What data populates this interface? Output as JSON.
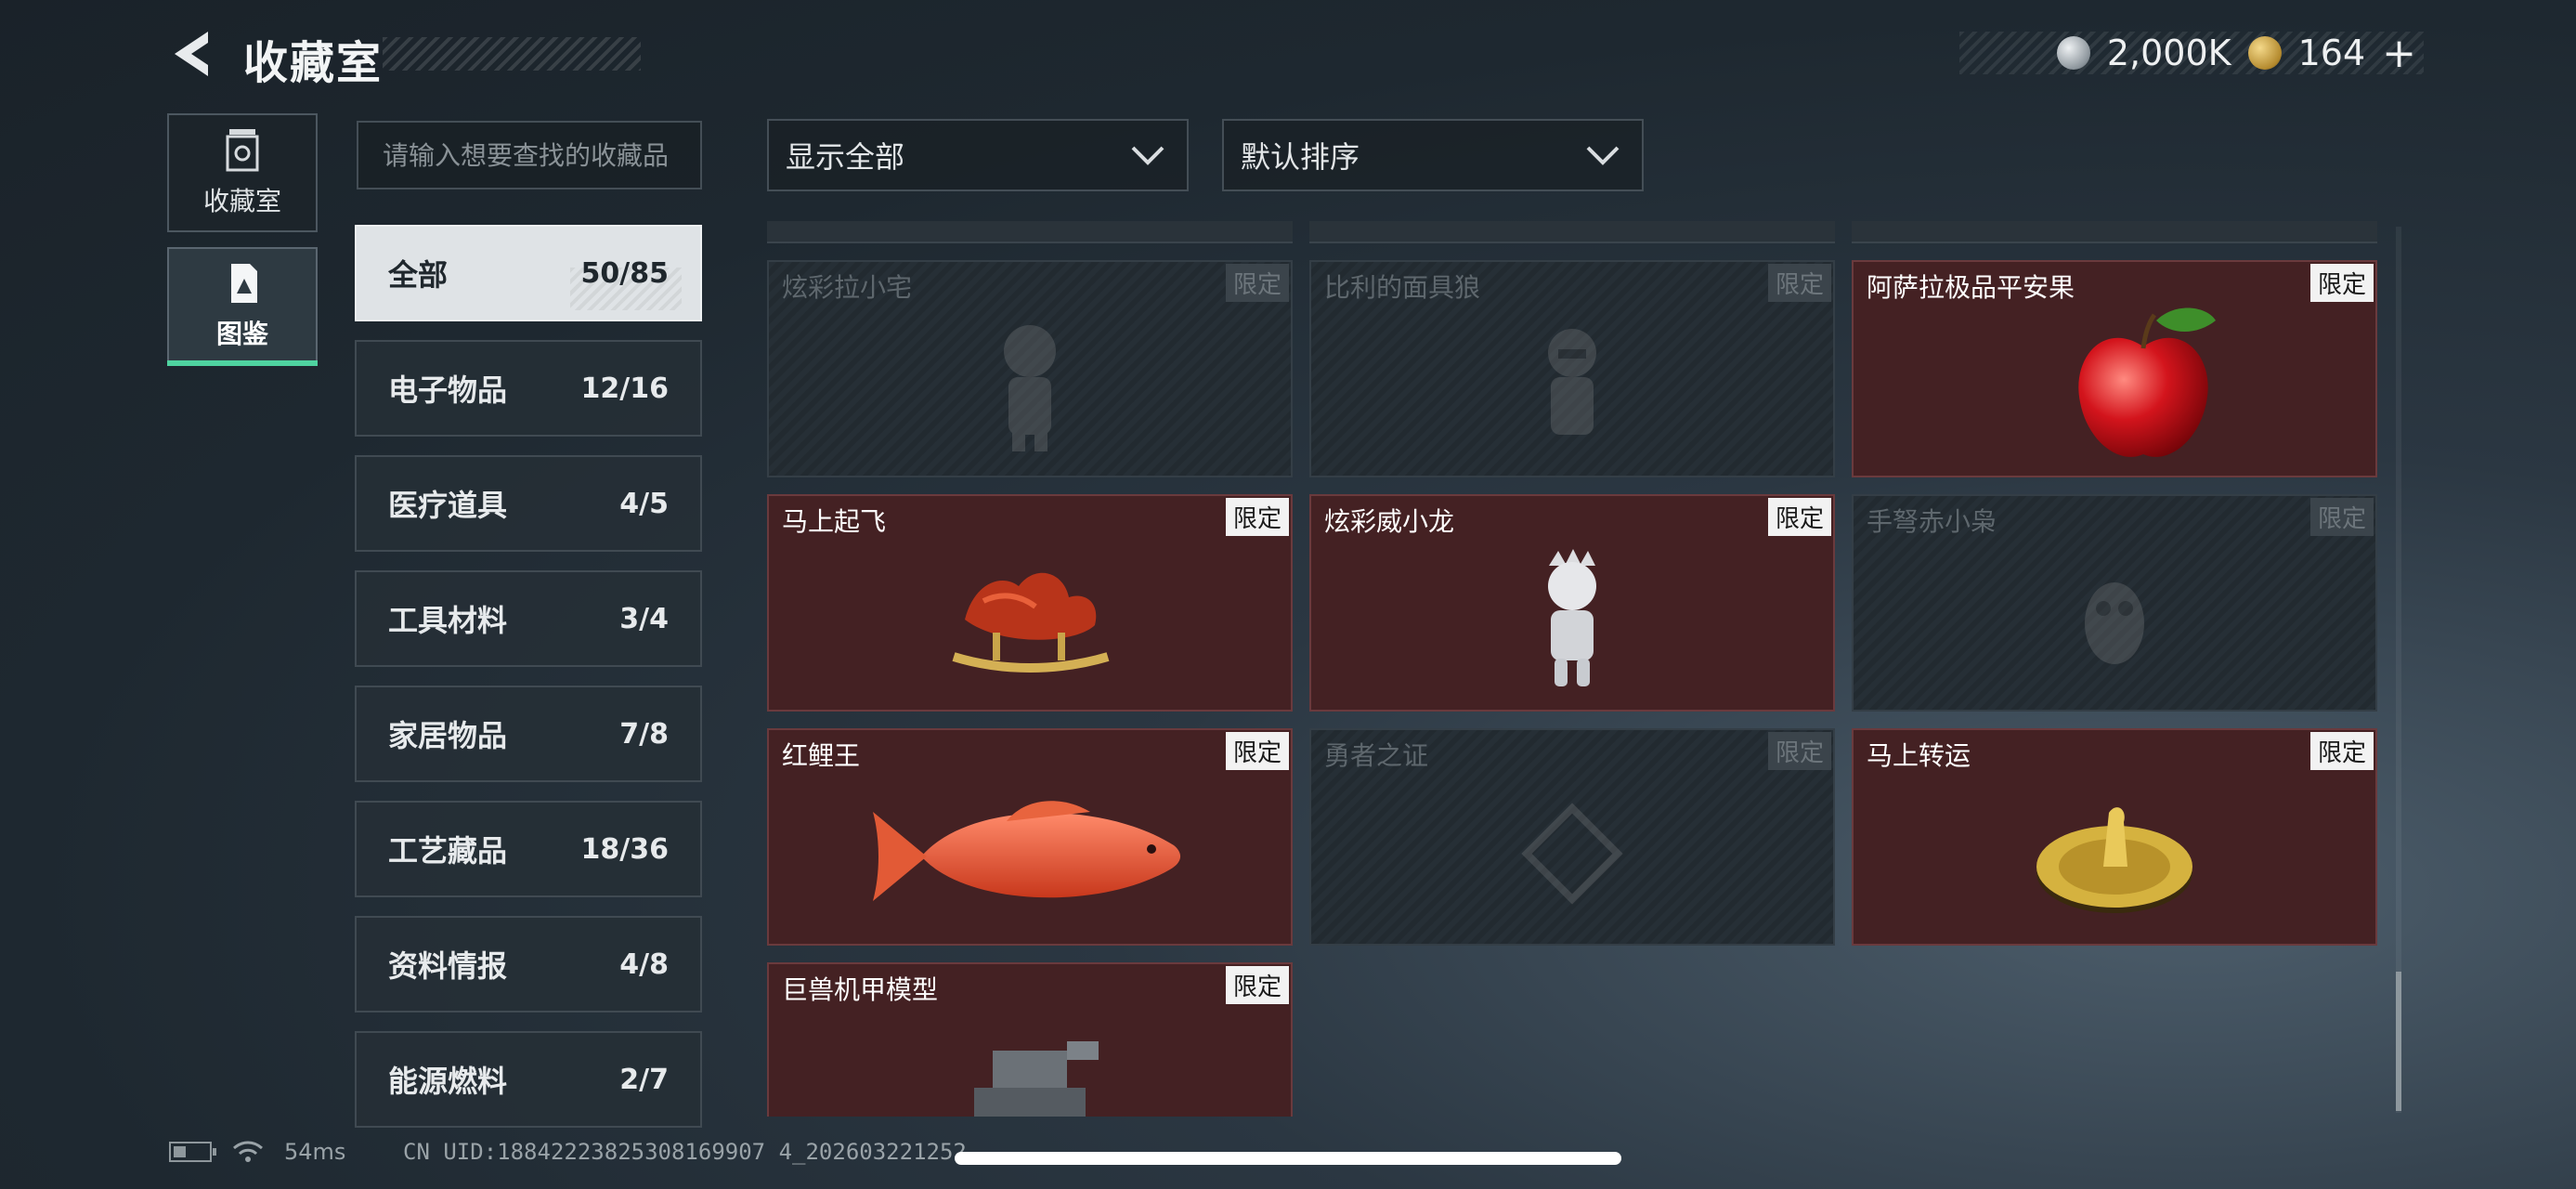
{
  "header": {
    "title": "收藏室",
    "currencies": [
      {
        "icon": "silver-coin-icon",
        "value": "2,000K"
      },
      {
        "icon": "gold-coin-icon",
        "value": "164"
      }
    ],
    "add_label": "+"
  },
  "nav": {
    "items": [
      {
        "label": "收藏室",
        "icon": "collection-room-icon",
        "active": false
      },
      {
        "label": "图鉴",
        "icon": "codex-icon",
        "active": true
      }
    ]
  },
  "search": {
    "placeholder": "请输入想要查找的收藏品"
  },
  "filters": {
    "display": "显示全部",
    "sort": "默认排序"
  },
  "categories": [
    {
      "name": "全部",
      "count": "50/85",
      "active": true
    },
    {
      "name": "电子物品",
      "count": "12/16"
    },
    {
      "name": "医疗道具",
      "count": "4/5"
    },
    {
      "name": "工具材料",
      "count": "3/4"
    },
    {
      "name": "家居物品",
      "count": "7/8"
    },
    {
      "name": "工艺藏品",
      "count": "18/36"
    },
    {
      "name": "资料情报",
      "count": "4/8"
    },
    {
      "name": "能源燃料",
      "count": "2/7"
    }
  ],
  "items": [
    {
      "name": "炫彩拉小宅",
      "tag": "限定",
      "owned": false,
      "icon": "figure-icon"
    },
    {
      "name": "比利的面具狼",
      "tag": "限定",
      "owned": false,
      "icon": "masked-figure-icon"
    },
    {
      "name": "阿萨拉极品平安果",
      "tag": "限定",
      "owned": true,
      "icon": "apple-icon"
    },
    {
      "name": "马上起飞",
      "tag": "限定",
      "owned": true,
      "icon": "rocking-horse-icon"
    },
    {
      "name": "炫彩威小龙",
      "tag": "限定",
      "owned": true,
      "icon": "dragon-figure-icon"
    },
    {
      "name": "手弩赤小枭",
      "tag": "限定",
      "owned": false,
      "icon": "owl-figure-icon"
    },
    {
      "name": "红鲤王",
      "tag": "限定",
      "owned": true,
      "icon": "carp-icon"
    },
    {
      "name": "勇者之证",
      "tag": "限定",
      "owned": false,
      "icon": "badge-icon"
    },
    {
      "name": "马上转运",
      "tag": "限定",
      "owned": true,
      "icon": "fortune-wheel-icon"
    },
    {
      "name": "巨兽机甲模型",
      "tag": "限定",
      "owned": true,
      "icon": "mech-model-icon"
    }
  ],
  "footer": {
    "battery_level": 0.35,
    "ping": "54ms",
    "uid": "CN UID:18842223825308169907 4_202603221252"
  },
  "colors": {
    "accent": "#4fd3a0",
    "owned_card": "#442123",
    "locked_card": "#262f36"
  }
}
